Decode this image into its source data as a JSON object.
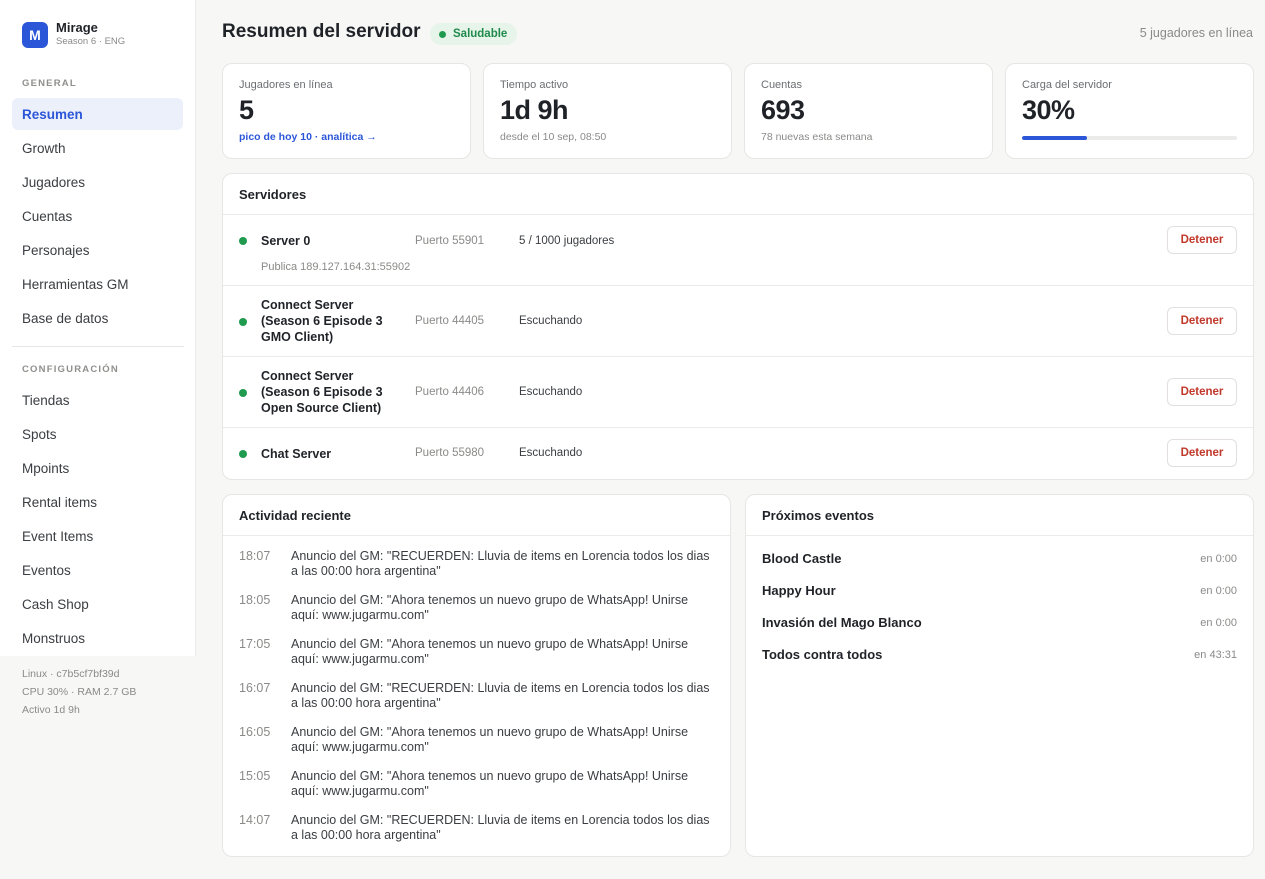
{
  "brand": {
    "logo_letter": "M",
    "name": "Mirage",
    "subtitle": "Season 6 · ENG"
  },
  "sidebar": {
    "general_label": "GENERAL",
    "general_items": [
      {
        "label": "Resumen",
        "active": true
      },
      {
        "label": "Growth"
      },
      {
        "label": "Jugadores"
      },
      {
        "label": "Cuentas"
      },
      {
        "label": "Personajes"
      },
      {
        "label": "Herramientas GM"
      },
      {
        "label": "Base de datos"
      }
    ],
    "config_label": "CONFIGURACIÓN",
    "config_items": [
      {
        "label": "Tiendas"
      },
      {
        "label": "Spots"
      },
      {
        "label": "Mpoints"
      },
      {
        "label": "Rental items"
      },
      {
        "label": "Event Items"
      },
      {
        "label": "Eventos"
      },
      {
        "label": "Cash Shop"
      },
      {
        "label": "Monstruos"
      }
    ],
    "system": [
      "Linux · c7b5cf7bf39d",
      "CPU 30% · RAM 2.7 GB",
      "Activo 1d 9h"
    ]
  },
  "header": {
    "title": "Resumen del servidor",
    "status_badge": "Saludable",
    "online_text": "5 jugadores en línea"
  },
  "stats": {
    "players": {
      "label": "Jugadores en línea",
      "value": "5",
      "link": "pico de hoy 10 · analítica →"
    },
    "uptime": {
      "label": "Tiempo activo",
      "value": "1d 9h",
      "sub": "desde el 10 sep, 08:50"
    },
    "accounts": {
      "label": "Cuentas",
      "value": "693",
      "sub": "78 nuevas esta semana"
    },
    "load": {
      "label": "Carga del servidor",
      "value": "30%",
      "percent": 30
    }
  },
  "servers": {
    "title": "Servidores",
    "stop_label": "Detener",
    "rows": [
      {
        "name": "Server 0",
        "port": "Puerto 55901",
        "status": "5 / 1000 jugadores",
        "public": "Publica 189.127.164.31:55902"
      },
      {
        "name": "Connect Server (Season 6 Episode 3 GMO Client)",
        "port": "Puerto 44405",
        "status": "Escuchando"
      },
      {
        "name": "Connect Server (Season 6 Episode 3 Open Source Client)",
        "port": "Puerto 44406",
        "status": "Escuchando"
      },
      {
        "name": "Chat Server",
        "port": "Puerto 55980",
        "status": "Escuchando"
      }
    ]
  },
  "activity": {
    "title": "Actividad reciente",
    "items": [
      {
        "time": "18:07",
        "text": "Anuncio del GM: \"RECUERDEN: Lluvia de items en Lorencia todos los dias a las 00:00 hora argentina\""
      },
      {
        "time": "18:05",
        "text": "Anuncio del GM: \"Ahora tenemos un nuevo grupo de WhatsApp! Unirse aquí: www.jugarmu.com\""
      },
      {
        "time": "17:05",
        "text": "Anuncio del GM: \"Ahora tenemos un nuevo grupo de WhatsApp! Unirse aquí: www.jugarmu.com\""
      },
      {
        "time": "16:07",
        "text": "Anuncio del GM: \"RECUERDEN: Lluvia de items en Lorencia todos los dias a las 00:00 hora argentina\""
      },
      {
        "time": "16:05",
        "text": "Anuncio del GM: \"Ahora tenemos un nuevo grupo de WhatsApp! Unirse aquí: www.jugarmu.com\""
      },
      {
        "time": "15:05",
        "text": "Anuncio del GM: \"Ahora tenemos un nuevo grupo de WhatsApp! Unirse aquí: www.jugarmu.com\""
      },
      {
        "time": "14:07",
        "text": "Anuncio del GM: \"RECUERDEN: Lluvia de items en Lorencia todos los dias a las 00:00 hora argentina\""
      }
    ]
  },
  "events": {
    "title": "Próximos eventos",
    "items": [
      {
        "name": "Blood Castle",
        "time": "en 0:00"
      },
      {
        "name": "Happy Hour",
        "time": "en 0:00"
      },
      {
        "name": "Invasión del Mago Blanco",
        "time": "en 0:00"
      },
      {
        "name": "Todos contra todos",
        "time": "en 43:31"
      }
    ]
  },
  "colors": {
    "accent": "#2c56d8",
    "success": "#1f9a4e",
    "danger": "#c0392b"
  }
}
